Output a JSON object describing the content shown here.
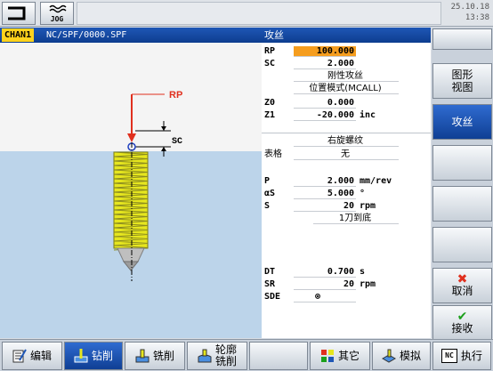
{
  "topbar": {
    "back_icon": "return-arrow-icon",
    "mode_label": "JOG",
    "date": "25.10.18",
    "time": "13:38"
  },
  "header": {
    "channel": "CHAN1",
    "program_path": "NC/SPF/0000.SPF",
    "screen_title": "攻丝"
  },
  "graphic": {
    "rp_label": "RP",
    "sc_label": "SC"
  },
  "params": {
    "rp": {
      "label": "RP",
      "value": "100.000"
    },
    "sc": {
      "label": "SC",
      "value": "2.000"
    },
    "tap_type": "刚性攻丝",
    "mode": "位置模式(MCALL)",
    "z0": {
      "label": "Z0",
      "value": "0.000"
    },
    "z1": {
      "label": "Z1",
      "value": "-20.000",
      "unit": "inc"
    },
    "thread_dir": "右旋螺纹",
    "table": {
      "label": "表格",
      "value": "无"
    },
    "p": {
      "label": "P",
      "value": "2.000",
      "unit": "mm/rev"
    },
    "as": {
      "label": "αS",
      "value": "5.000",
      "unit": "°"
    },
    "s": {
      "label": "S",
      "value": "20",
      "unit": "rpm"
    },
    "machining": "1刀到底",
    "dt": {
      "label": "DT",
      "value": "0.700",
      "unit": "s"
    },
    "sr": {
      "label": "SR",
      "value": "20",
      "unit": "rpm"
    },
    "sde": {
      "label": "SDE",
      "value": "⊗"
    }
  },
  "vkeys": {
    "graphic_view_line1": "图形",
    "graphic_view_line2": "视图",
    "tapping": "攻丝",
    "cancel": "取消",
    "accept": "接收"
  },
  "hkeys": {
    "edit": "编辑",
    "drill": "钻削",
    "mill": "铣削",
    "contour_line1": "轮廓",
    "contour_line2": "铣削",
    "other": "其它",
    "simulate": "模拟",
    "execute": "执行",
    "nc_badge": "NC"
  },
  "colors": {
    "header_blue": "#0d3d8f",
    "channel_yellow": "#ffd21c",
    "highlight_orange": "#f59d1e",
    "workpiece_blue": "#bcd4ea",
    "rp_arrow_red": "#e0301e",
    "tap_yellow": "#e6e61e"
  }
}
